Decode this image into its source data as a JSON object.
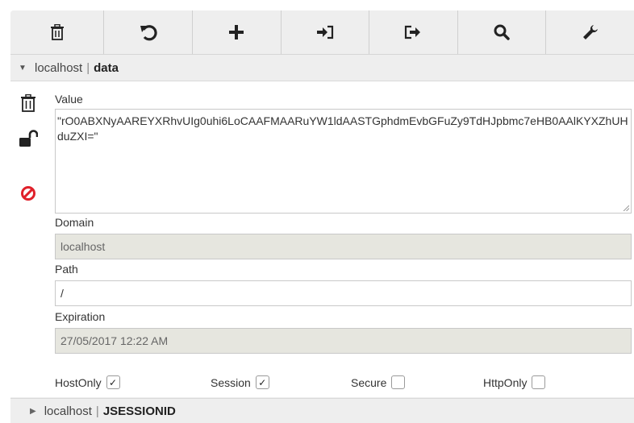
{
  "toolbar": {
    "buttons": [
      {
        "name": "trash-icon"
      },
      {
        "name": "undo-icon"
      },
      {
        "name": "plus-icon"
      },
      {
        "name": "sign-in-icon"
      },
      {
        "name": "sign-out-icon"
      },
      {
        "name": "search-icon"
      },
      {
        "name": "wrench-icon"
      }
    ]
  },
  "cookies": [
    {
      "domain": "localhost",
      "separator": "|",
      "name": "data",
      "expanded": true
    },
    {
      "domain": "localhost",
      "separator": "|",
      "name": "JSESSIONID",
      "expanded": false
    }
  ],
  "editor": {
    "value_label": "Value",
    "value": "\"rO0ABXNyAAREYXRhvUIg0uhi6LoCAAFMAARuYW1ldAASTGphdmEvbGFuZy9TdHJpbmc7eHB0AAlKYXZhUHduZXI=\"",
    "domain_label": "Domain",
    "domain": "localhost",
    "path_label": "Path",
    "path": "/",
    "expiration_label": "Expiration",
    "expiration": "27/05/2017 12:22 AM",
    "flags": [
      {
        "label": "HostOnly",
        "checked": true
      },
      {
        "label": "Session",
        "checked": true
      },
      {
        "label": "Secure",
        "checked": false
      },
      {
        "label": "HttpOnly",
        "checked": false
      }
    ],
    "side_icons": [
      "trash-icon",
      "unlock-icon",
      "block-icon"
    ],
    "colors": {
      "block": "#e0202a",
      "readonly_bg": "#e6e6df",
      "panel_bg": "#eeeeee"
    }
  }
}
